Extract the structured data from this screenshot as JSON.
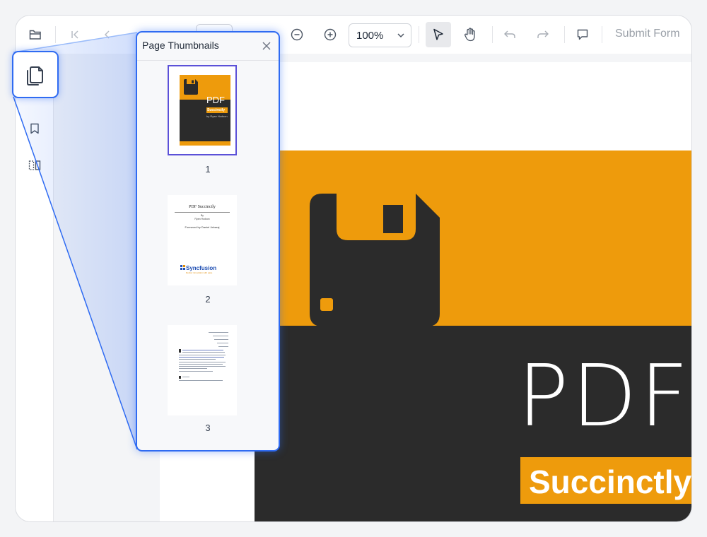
{
  "toolbar": {
    "zoom_value": "100%",
    "submit_label": "Submit Form",
    "icons": [
      "folder-open-icon",
      "first-page-icon",
      "previous-page-icon",
      "next-page-icon",
      "zoom-out-icon",
      "zoom-in-icon",
      "select-pointer-icon",
      "pan-hand-icon",
      "undo-icon",
      "redo-icon",
      "comment-icon"
    ]
  },
  "sidebar": {
    "items": [
      {
        "name": "page-thumbnails-icon"
      },
      {
        "name": "bookmark-icon"
      },
      {
        "name": "organize-pages-icon"
      }
    ]
  },
  "thumbnails_panel": {
    "title": "Page Thumbnails",
    "pages": [
      {
        "label": "1",
        "selected": true
      },
      {
        "label": "2",
        "selected": false
      },
      {
        "label": "3",
        "selected": false
      }
    ],
    "page2": {
      "title": "PDF Succinctly",
      "by": "By",
      "author": "Ryan Hodson",
      "foreword": "Foreword by Daniel Jebaraj",
      "logo": "Syncfusion",
      "tagline": "Deliver innovation with ease"
    }
  },
  "document": {
    "cover_title": "PDF",
    "cover_badge": "Succinctly",
    "thumb_cover_title": "PDF",
    "thumb_cover_badge": "Succinctly",
    "thumb_cover_by": "by Ryan Hodson"
  },
  "colors": {
    "accent": "#2f6bf2",
    "cover_orange": "#ee9b0c",
    "cover_dark": "#2b2b2b",
    "thumb_selected": "#5b51d8"
  }
}
